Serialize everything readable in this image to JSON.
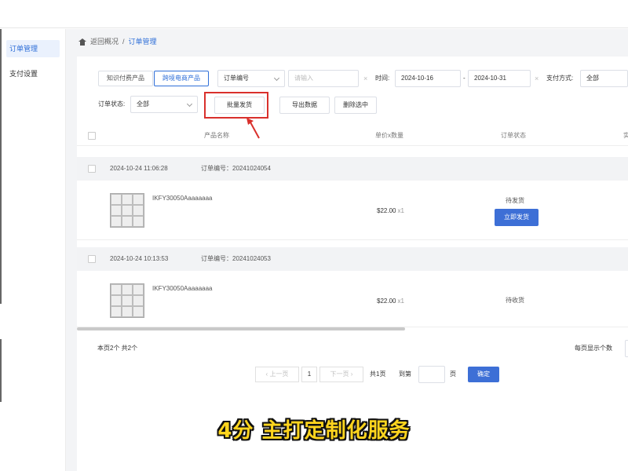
{
  "sidebar": {
    "items": [
      {
        "label": "订单管理",
        "active": true
      },
      {
        "label": "支付设置",
        "active": false
      }
    ]
  },
  "breadcrumb": {
    "back": "返回概况",
    "sep": "/",
    "current": "订单管理"
  },
  "filters": {
    "product_tabs": [
      "知识付费产品",
      "跨境电商产品"
    ],
    "order_no_select": "订单编号",
    "order_no_placeholder": "请输入",
    "time_label": "时间:",
    "date_from": "2024-10-16",
    "date_sep": "-",
    "date_to": "2024-10-31",
    "pay_label": "支付方式:",
    "pay_value": "全部",
    "status_label": "订单状态:",
    "status_value": "全部",
    "clear_icon": "x-icon"
  },
  "actions": {
    "batch_ship": "批量发货",
    "export": "导出数据",
    "delete_selected": "删除选中"
  },
  "table": {
    "headers": [
      "产品名称",
      "单价x数量",
      "订单状态",
      "实"
    ],
    "orders": [
      {
        "time": "2024-10-24 11:06:28",
        "order_no": "订单编号：20241024054",
        "product": "IKFY30050Aaaaaaaa",
        "price": "$22.00",
        "qty": "x1",
        "status": "待发货",
        "ship_button": "立即发货"
      },
      {
        "time": "2024-10-24 10:13:53",
        "order_no": "订单编号：20241024053",
        "product": "IKFY30050Aaaaaaaa",
        "price": "$22.00",
        "qty": "x1",
        "status": "待收货",
        "ship_button": ""
      }
    ]
  },
  "pagination": {
    "summary": "本页2个 共2个",
    "prev": "上一页",
    "page": "1",
    "next": "下一页",
    "total_pages": "共1页",
    "goto_label": "到第",
    "goto_suffix": "页",
    "confirm": "确定",
    "per_page_label": "每页显示个数"
  },
  "caption": "4分 主打定制化服务",
  "colors": {
    "accent": "#2f6fd8",
    "highlight": "#d9302c",
    "caption": "#ffd51e"
  }
}
